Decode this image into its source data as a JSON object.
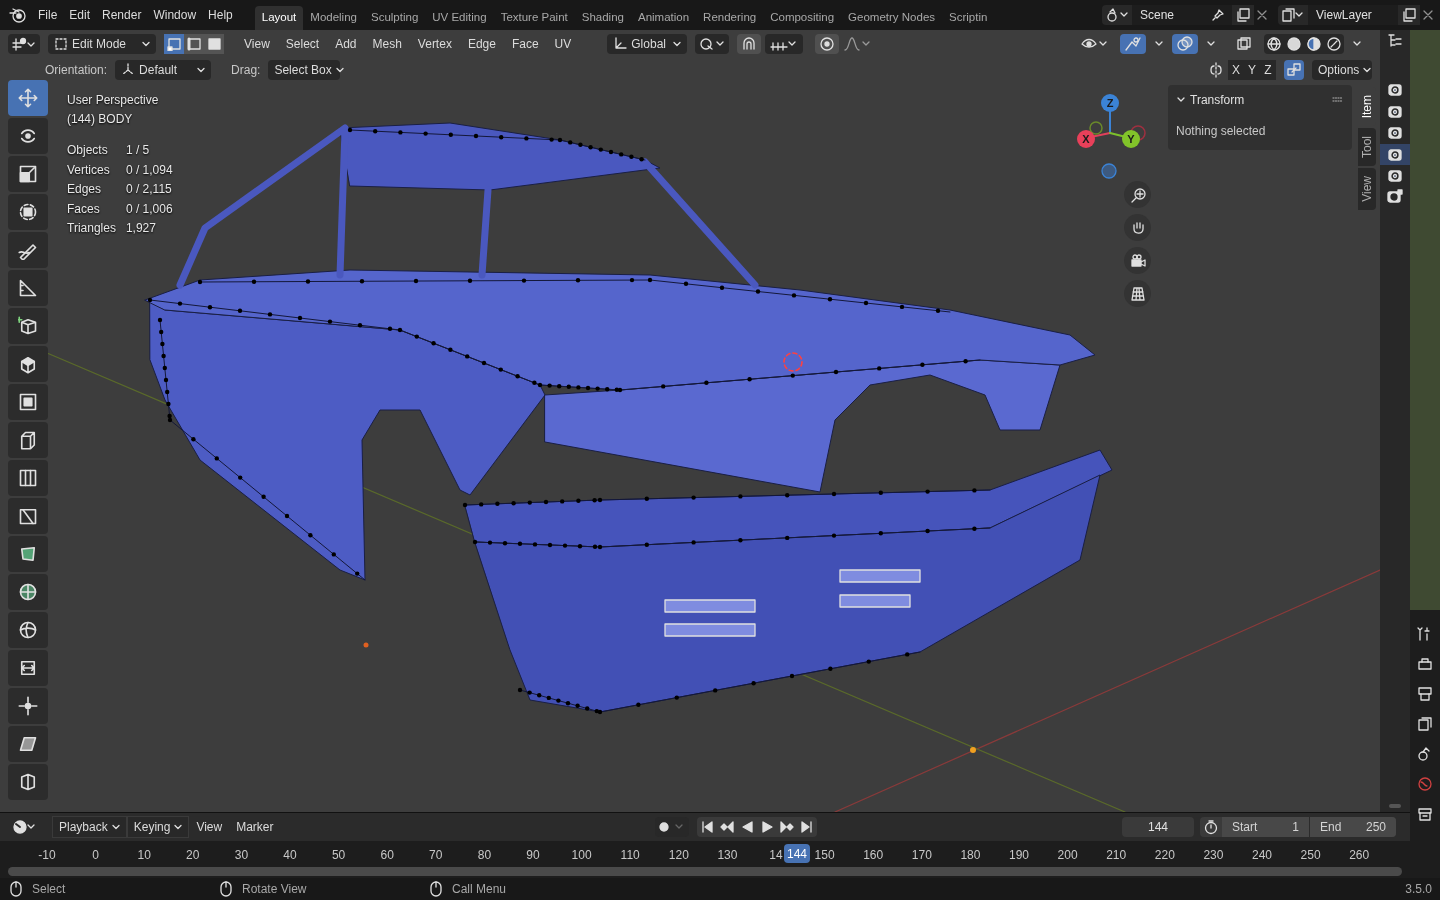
{
  "menu_bar": {
    "menus": [
      "File",
      "Edit",
      "Render",
      "Window",
      "Help"
    ],
    "workspaces": [
      {
        "label": "Layout",
        "selected": true
      },
      {
        "label": "Modeling",
        "selected": false
      },
      {
        "label": "Sculpting",
        "selected": false
      },
      {
        "label": "UV Editing",
        "selected": false
      },
      {
        "label": "Texture Paint",
        "selected": false
      },
      {
        "label": "Shading",
        "selected": false
      },
      {
        "label": "Animation",
        "selected": false
      },
      {
        "label": "Rendering",
        "selected": false
      },
      {
        "label": "Compositing",
        "selected": false
      },
      {
        "label": "Geometry Nodes",
        "selected": false
      },
      {
        "label": "Scriptin",
        "selected": false
      }
    ],
    "scene": "Scene",
    "view_layer": "ViewLayer"
  },
  "viewport_header": {
    "mode": "Edit Mode",
    "select_modes": [
      {
        "kind": "vertex",
        "selected": true
      },
      {
        "kind": "edge",
        "selected": false
      },
      {
        "kind": "face",
        "selected": false
      }
    ],
    "menus": [
      "View",
      "Select",
      "Add",
      "Mesh",
      "Vertex",
      "Edge",
      "Face",
      "UV"
    ],
    "transform_orientation": "Global"
  },
  "tool_settings": {
    "orientation_label": "Orientation:",
    "orientation": "Default",
    "drag_label": "Drag:",
    "drag": "Select Box",
    "axes": [
      "X",
      "Y",
      "Z"
    ],
    "options": "Options"
  },
  "toolbar": [
    {
      "kind": "move",
      "selected": true
    },
    {
      "kind": "rotate",
      "selected": false
    },
    {
      "kind": "scale",
      "selected": false
    },
    {
      "kind": "transform",
      "selected": false
    },
    {
      "kind": "annotate",
      "selected": false
    },
    {
      "kind": "measure",
      "selected": false
    },
    {
      "kind": "add_cube",
      "selected": false
    },
    {
      "kind": "extrude",
      "selected": false
    },
    {
      "kind": "inset",
      "selected": false
    },
    {
      "kind": "bevel",
      "selected": false
    },
    {
      "kind": "loop_cut",
      "selected": false
    },
    {
      "kind": "knife",
      "selected": false
    },
    {
      "kind": "poly_build",
      "selected": false
    },
    {
      "kind": "spin",
      "selected": false
    },
    {
      "kind": "smooth",
      "selected": false
    },
    {
      "kind": "edge_slide",
      "selected": false
    },
    {
      "kind": "shrink",
      "selected": false
    },
    {
      "kind": "shear",
      "selected": false
    },
    {
      "kind": "rip",
      "selected": false
    }
  ],
  "overlay": {
    "view_name": "User Perspective",
    "object": "(144) BODY",
    "stats": [
      {
        "label": "Objects",
        "value": "1 / 5"
      },
      {
        "label": "Vertices",
        "value": "0 / 1,094"
      },
      {
        "label": "Edges",
        "value": "0 / 2,115"
      },
      {
        "label": "Faces",
        "value": "0 / 1,006"
      },
      {
        "label": "Triangles",
        "value": "1,927"
      }
    ]
  },
  "gizmo": {
    "axes": [
      "X",
      "Y",
      "Z"
    ]
  },
  "sidebar": {
    "tabs": [
      {
        "label": "Item",
        "selected": true
      },
      {
        "label": "Tool",
        "selected": false
      },
      {
        "label": "View",
        "selected": false
      }
    ],
    "panel_title": "Transform",
    "message": "Nothing selected"
  },
  "outliner_toggles": [
    {
      "selected": false
    },
    {
      "selected": false
    },
    {
      "selected": false
    },
    {
      "selected": true
    },
    {
      "selected": false
    }
  ],
  "timeline": {
    "menus": [
      "Playback",
      "Keying",
      "View",
      "Marker"
    ],
    "current_frame": "144",
    "start_label": "Start",
    "start": "1",
    "end_label": "End",
    "end": "250",
    "ruler": [
      "-10",
      "0",
      "10",
      "20",
      "30",
      "40",
      "50",
      "60",
      "70",
      "80",
      "90",
      "100",
      "110",
      "120",
      "130",
      "14",
      "150",
      "160",
      "170",
      "180",
      "190",
      "200",
      "210",
      "220",
      "230",
      "240",
      "250",
      "260"
    ],
    "playhead": "144"
  },
  "status_bar": {
    "hints": [
      "Select",
      "Rotate View",
      "Call Menu"
    ],
    "version": "3.5.0"
  }
}
